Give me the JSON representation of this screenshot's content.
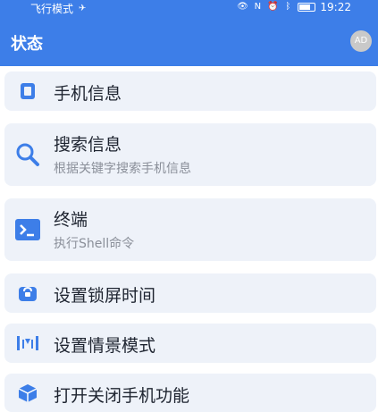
{
  "status_bar": {
    "left_text": "飞行模式",
    "time": "19:22"
  },
  "app_bar": {
    "title": "状态",
    "badge": "AD"
  },
  "items": [
    {
      "title": "手机信息",
      "icon": "phone-icon"
    },
    {
      "title": "搜索信息",
      "subtitle": "根据关键字搜索手机信息",
      "icon": "search-icon"
    },
    {
      "title": "终端",
      "subtitle": "执行Shell命令",
      "icon": "terminal-icon"
    },
    {
      "title": "设置锁屏时间",
      "icon": "lock-icon"
    },
    {
      "title": "设置情景模式",
      "icon": "scene-mode-icon"
    },
    {
      "title": "打开关闭手机功能",
      "icon": "cube-icon"
    }
  ],
  "colors": {
    "primary": "#3d7ee8",
    "card_bg": "#eef2f9"
  }
}
